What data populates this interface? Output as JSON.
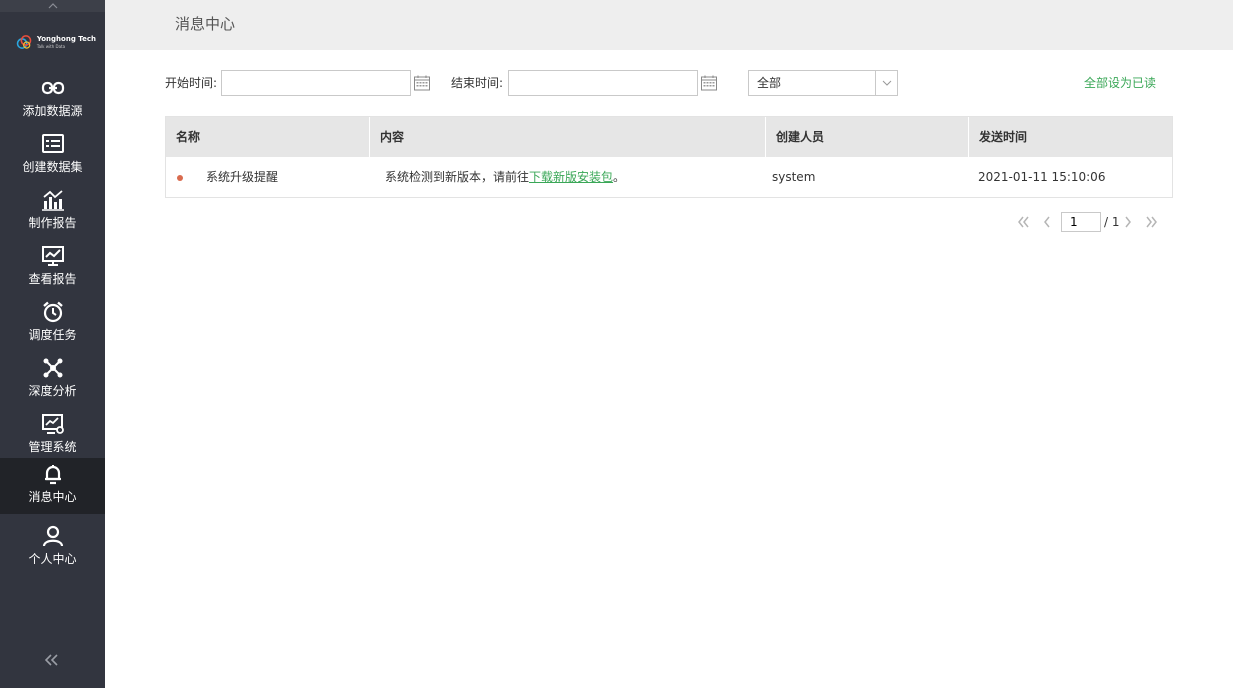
{
  "sidebar": {
    "logo": {
      "name": "Yonghong Tech",
      "tagline": "Talk with Data"
    },
    "items": [
      {
        "label": "添加数据源",
        "icon": "link-icon"
      },
      {
        "label": "创建数据集",
        "icon": "dataset-icon"
      },
      {
        "label": "制作报告",
        "icon": "bar-chart-icon"
      },
      {
        "label": "查看报告",
        "icon": "presentation-chart-icon"
      },
      {
        "label": "调度任务",
        "icon": "alarm-clock-icon"
      },
      {
        "label": "深度分析",
        "icon": "network-nodes-icon"
      },
      {
        "label": "管理系统",
        "icon": "monitor-gear-icon"
      },
      {
        "label": "消息中心",
        "icon": "bell-icon",
        "active": true
      },
      {
        "label": "个人中心",
        "icon": "user-icon"
      }
    ]
  },
  "header": {
    "title": "消息中心"
  },
  "filters": {
    "start_label": "开始时间:",
    "start_value": "",
    "end_label": "结束时间:",
    "end_value": "",
    "status_selected": "全部",
    "mark_all_read": "全部设为已读"
  },
  "table": {
    "columns": [
      "名称",
      "内容",
      "创建人员",
      "发送时间"
    ],
    "rows": [
      {
        "unread": true,
        "name": "系统升级提醒",
        "content_prefix": "系统检测到新版本，请前往",
        "content_link": "下载新版安装包",
        "content_suffix": "。",
        "creator": "system",
        "time": "2021-01-11 15:10:06"
      }
    ]
  },
  "pagination": {
    "current": "1",
    "total": "/ 1"
  },
  "colors": {
    "sidebar_bg": "#32353f",
    "accent_green": "#3aa757",
    "unread_dot": "#d96b4e"
  }
}
